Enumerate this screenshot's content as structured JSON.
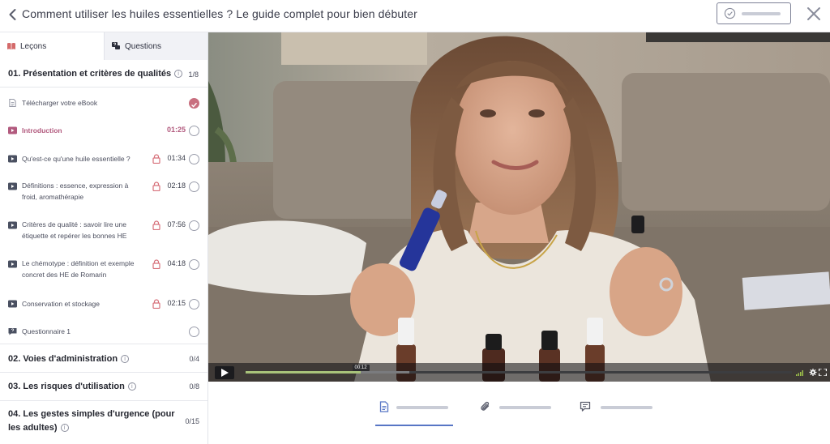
{
  "header": {
    "course_title": "Comment utiliser les huiles essentielles ? Le guide complet pour bien débuter",
    "back_icon": "chevron-left-icon",
    "close_icon": "close-icon"
  },
  "sidebar": {
    "tabs": [
      {
        "label": "Leçons",
        "icon": "book-icon",
        "active": true
      },
      {
        "label": "Questions",
        "icon": "chat-question-icon",
        "active": false
      }
    ],
    "chapters": [
      {
        "title": "01. Présentation et critères de qualités",
        "count": "1/8",
        "expanded": true
      },
      {
        "title": "02. Voies d'administration",
        "count": "0/4",
        "expanded": false
      },
      {
        "title": "03. Les risques d'utilisation",
        "count": "0/8",
        "expanded": false
      },
      {
        "title_line1": "04. Les gestes simples d'urgence (pour",
        "title_line2": "les adultes)",
        "count": "0/15",
        "expanded": false
      }
    ],
    "lessons": [
      {
        "type": "document",
        "title": "Télécharger votre eBook",
        "duration": "",
        "locked": false,
        "completed": true
      },
      {
        "type": "video",
        "title": "Introduction",
        "duration": "01:25",
        "locked": false,
        "completed": false,
        "active": true
      },
      {
        "type": "video",
        "title": "Qu'est-ce qu'une huile essentielle ?",
        "duration": "01:34",
        "locked": true,
        "completed": false
      },
      {
        "type": "video",
        "title_line1": "Définitions : essence, expression à",
        "title_line2": "froid, aromathérapie",
        "duration": "02:18",
        "locked": true,
        "completed": false
      },
      {
        "type": "video",
        "title_line1": "Critères de qualité : savoir lire une",
        "title_line2": "étiquette et repérer les bonnes HE",
        "duration": "07:56",
        "locked": true,
        "completed": false
      },
      {
        "type": "video",
        "title_line1": "Le chémotype : définition et exemple",
        "title_line2": "concret des HE de Romarin",
        "duration": "04:18",
        "locked": true,
        "completed": false
      },
      {
        "type": "video",
        "title": "Conservation et stockage",
        "duration": "02:15",
        "locked": true,
        "completed": false
      },
      {
        "type": "quiz",
        "title": "Questionnaire 1",
        "duration": "",
        "locked": false,
        "completed": false
      }
    ]
  },
  "player": {
    "current_time": "00:12",
    "progress": 0.21,
    "buffered_end": 0.3,
    "play_icon": "play-icon",
    "volume_icon": "volume-icon",
    "settings_icon": "settings-gear-icon",
    "fullscreen_icon": "fullscreen-icon"
  },
  "content_tabs": [
    {
      "icon": "document-icon",
      "active": true
    },
    {
      "icon": "paperclip-icon",
      "active": false
    },
    {
      "icon": "comment-icon",
      "active": false
    }
  ],
  "colors": {
    "accent": "#b25a7e",
    "completed": "#c86f7f",
    "lock": "#d7707a",
    "active_tab_underline": "#5876c5",
    "scrub_played": "#a8c27a"
  }
}
